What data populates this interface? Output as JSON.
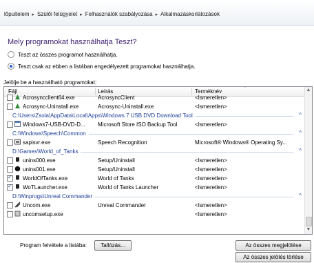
{
  "breadcrumb": [
    "lőpultelem",
    "Szülői felügyelet",
    "Felhasználók szabályozása",
    "Alkalmazáskorlátozások"
  ],
  "question": "Mely programokat használhatja Teszt?",
  "radios": [
    {
      "label": "Teszt az összes programot használhatja.",
      "checked": false
    },
    {
      "label": "Teszt csak az ebben a listában engedélyezett programokat használhatja.",
      "checked": true
    }
  ],
  "list_label": "Jelölje be a használható programokat:",
  "columns": [
    "Fájl",
    "Leírás",
    "Terméknév"
  ],
  "rows": [
    {
      "type": "item",
      "file": "Acrosyncclient64.exe",
      "desc": "AcrosyncClient",
      "product": "<Ismeretlen>",
      "checked": false,
      "icon": "acrosync-icon"
    },
    {
      "type": "item",
      "file": "Acrosync-Uninstall.exe",
      "desc": "Acrosync-Uninstall.exe",
      "product": "<Ismeretlen>",
      "checked": false,
      "icon": "acrosync-icon"
    },
    {
      "type": "group",
      "text": "C:\\Users\\Zsola\\AppData\\Local\\Apps\\Windows 7 USB DVD Download Tool"
    },
    {
      "type": "item",
      "file": "Windows7-USB-DVD-D...",
      "desc": "Microsoft Store ISO Backup Tool",
      "product": "<Ismeretlen>",
      "checked": false,
      "icon": "app-window-icon"
    },
    {
      "type": "group",
      "text": "C:\\Windows\\Speech\\Common"
    },
    {
      "type": "item",
      "file": "sapisvr.exe",
      "desc": "Speech Recognition",
      "product": "Microsoft® Windows® Operating Sy...",
      "checked": false,
      "icon": "speech-app-icon"
    },
    {
      "type": "group",
      "text": "D:\\Games\\World_of_Tanks"
    },
    {
      "type": "item",
      "file": "unins000.exe",
      "desc": "Setup/Uninstall",
      "product": "<Ismeretlen>",
      "checked": false,
      "icon": "wot-icon"
    },
    {
      "type": "item",
      "file": "unins001.exe",
      "desc": "Setup/Uninstall",
      "product": "<Ismeretlen>",
      "checked": false,
      "icon": "black-circle-icon"
    },
    {
      "type": "item",
      "file": "WorldOfTanks.exe",
      "desc": "World of Tanks",
      "product": "<Ismeretlen>",
      "checked": true,
      "icon": "wot-icon"
    },
    {
      "type": "item",
      "file": "WoTLauncher.exe",
      "desc": "World of Tanks Launcher",
      "product": "<Ismeretlen>",
      "checked": true,
      "icon": "wot-icon"
    },
    {
      "type": "group",
      "text": "D:\\Winprogs\\Unreal Commander"
    },
    {
      "type": "item",
      "file": "Uncom.exe",
      "desc": "Unreal Commander",
      "product": "<Ismeretlen>",
      "checked": false,
      "icon": "unreal-commander-icon"
    },
    {
      "type": "item",
      "file": "uncomsetup.exe",
      "desc": "",
      "product": "<Ismeretlen>",
      "checked": false,
      "icon": "setup-icon"
    }
  ],
  "buttons": {
    "add_label": "Program felvétele a listába:",
    "browse": "Tallózás...",
    "select_all": "Az összes megjelölése",
    "clear_all": "Az összes jelölés törlése"
  }
}
